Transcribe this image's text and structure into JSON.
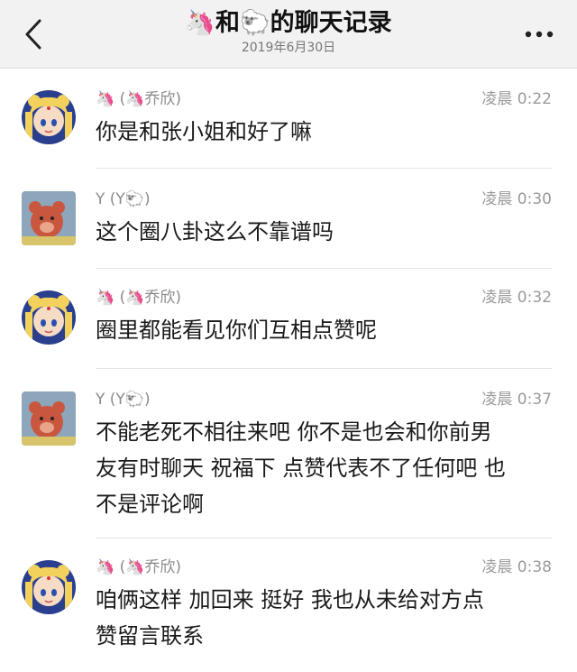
{
  "header": {
    "title": "🦄和🐑的聊天记录",
    "subtitle": "2019年6月30日",
    "back_icon": "chevron-left-icon",
    "more_icon": "more-dots-icon"
  },
  "colors": {
    "header_bg": "#f2f2f2",
    "name_text": "#8a8a8a",
    "time_text": "#9a9a9a",
    "message_text": "#1a1a1a"
  },
  "messages": [
    {
      "name": "🦄 (🦄乔欣)",
      "time": "凌晨 0:22",
      "text": "你是和张小姐和好了嘛",
      "avatar": "sailor-moon-avatar"
    },
    {
      "name": "Y (Y🐑)",
      "time": "凌晨 0:30",
      "text": "这个圈八卦这么不靠谱吗",
      "avatar": "bear-avatar"
    },
    {
      "name": "🦄 (🦄乔欣)",
      "time": "凌晨 0:32",
      "text": "圈里都能看见你们互相点赞呢",
      "avatar": "sailor-moon-avatar"
    },
    {
      "name": "Y (Y🐑)",
      "time": "凌晨 0:37",
      "text": "不能老死不相往来吧 你不是也会和你前男\n友有时聊天 祝福下 点赞代表不了任何吧 也\n不是评论啊",
      "avatar": "bear-avatar"
    },
    {
      "name": "🦄 (🦄乔欣)",
      "time": "凌晨 0:38",
      "text": "咱俩这样 加回来 挺好  我也从未给对方点\n赞留言联系",
      "avatar": "sailor-moon-avatar"
    }
  ]
}
